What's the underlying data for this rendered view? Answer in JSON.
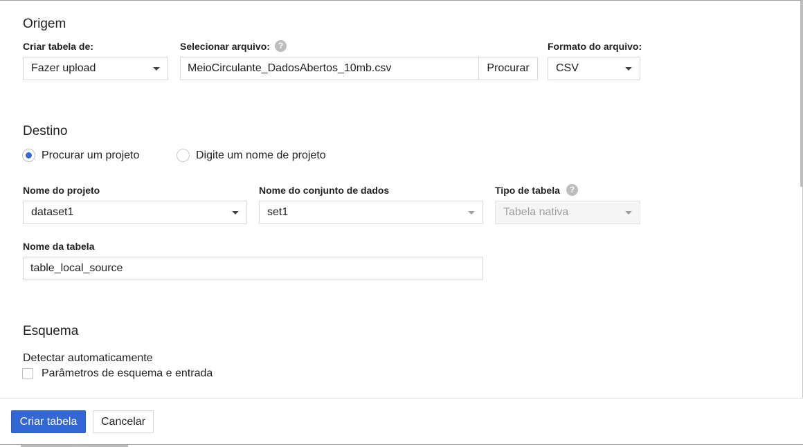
{
  "origin": {
    "title": "Origem",
    "create_from_label": "Criar tabela de:",
    "create_from_value": "Fazer upload",
    "select_file_label": "Selecionar arquivo:",
    "help_glyph": "?",
    "file_value": "MeioCirculante_DadosAbertos_10mb.csv",
    "browse_label": "Procurar",
    "file_format_label": "Formato do arquivo:",
    "file_format_value": "CSV"
  },
  "destination": {
    "title": "Destino",
    "radio_search_project": "Procurar um projeto",
    "radio_type_project": "Digite um nome de projeto",
    "selected_radio": "search",
    "project_label": "Nome do projeto",
    "project_value": "dataset1",
    "dataset_label": "Nome do conjunto de dados",
    "dataset_value": "set1",
    "table_type_label": "Tipo de tabela",
    "table_type_value": "Tabela nativa",
    "table_name_label": "Nome da tabela",
    "table_name_value": "table_local_source"
  },
  "schema": {
    "title": "Esquema",
    "auto_detect_label": "Detectar automaticamente",
    "schema_params_label": "Parâmetros de esquema e entrada",
    "schema_params_checked": false
  },
  "footer": {
    "create_button": "Criar tabela",
    "cancel_button": "Cancelar"
  },
  "colors": {
    "primary": "#3367d6",
    "border": "#d6d6d6",
    "disabled_text": "#9e9e9e"
  }
}
